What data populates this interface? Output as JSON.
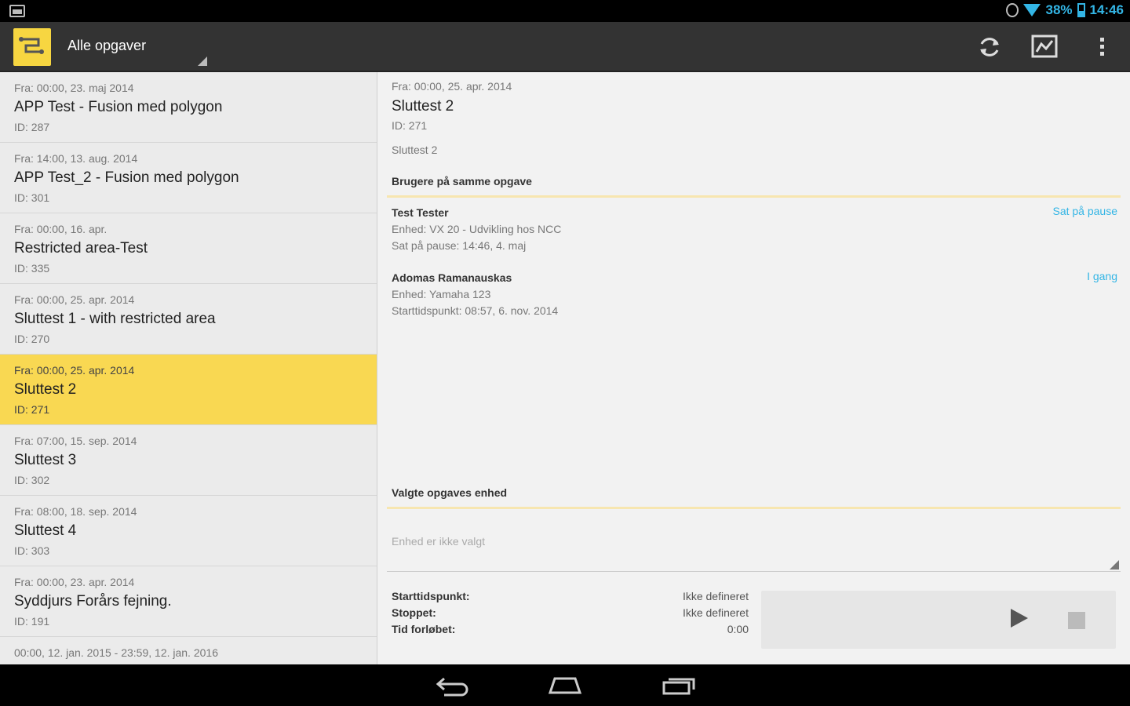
{
  "status_bar": {
    "battery": "38%",
    "time": "14:46"
  },
  "action_bar": {
    "title": "Alle opgaver"
  },
  "task_list": [
    {
      "from": "Fra: 00:00, 23. maj 2014",
      "title": "APP Test - Fusion med polygon",
      "id": "ID: 287",
      "selected": false
    },
    {
      "from": "Fra: 14:00, 13. aug. 2014",
      "title": "APP Test_2 - Fusion med polygon",
      "id": "ID: 301",
      "selected": false
    },
    {
      "from": "Fra: 00:00, 16. apr.",
      "title": "Restricted area-Test",
      "id": "ID: 335",
      "selected": false
    },
    {
      "from": "Fra: 00:00, 25. apr. 2014",
      "title": "Sluttest 1 - with restricted area",
      "id": "ID: 270",
      "selected": false
    },
    {
      "from": "Fra: 00:00, 25. apr. 2014",
      "title": "Sluttest 2",
      "id": "ID: 271",
      "selected": true
    },
    {
      "from": "Fra: 07:00, 15. sep. 2014",
      "title": "Sluttest 3",
      "id": "ID: 302",
      "selected": false
    },
    {
      "from": "Fra: 08:00, 18. sep. 2014",
      "title": "Sluttest 4",
      "id": "ID: 303",
      "selected": false
    },
    {
      "from": "Fra: 00:00, 23. apr. 2014",
      "title": "Syddjurs Forårs fejning.",
      "id": "ID: 191",
      "selected": false
    },
    {
      "from": "00:00, 12. jan. 2015 - 23:59, 12. jan. 2016",
      "title": "",
      "id": "",
      "selected": false
    }
  ],
  "detail": {
    "from": "Fra: 00:00, 25. apr. 2014",
    "title": "Sluttest 2",
    "id": "ID: 271",
    "description": "Sluttest 2",
    "users_header": "Brugere på samme opgave",
    "users": [
      {
        "name": "Test Tester",
        "unit": "Enhed: VX 20 - Udvikling hos NCC",
        "extra": "Sat på pause: 14:46, 4. maj",
        "status": "Sat på pause"
      },
      {
        "name": "Adomas Ramanauskas",
        "unit": "Enhed: Yamaha 123",
        "extra": "Starttidspunkt: 08:57, 6. nov. 2014",
        "status": "I gang"
      }
    ],
    "unit_header": "Valgte opgaves enhed",
    "unit_placeholder": "Enhed er ikke valgt",
    "timing": {
      "start_label": "Starttidspunkt:",
      "start_value": "Ikke defineret",
      "stopped_label": "Stoppet:",
      "stopped_value": "Ikke defineret",
      "elapsed_label": "Tid forløbet:",
      "elapsed_value": "0:00"
    }
  },
  "colors": {
    "accent": "#33b5e5",
    "selected": "#f9d852",
    "app_icon": "#f7d641",
    "action_bar": "#333333"
  }
}
